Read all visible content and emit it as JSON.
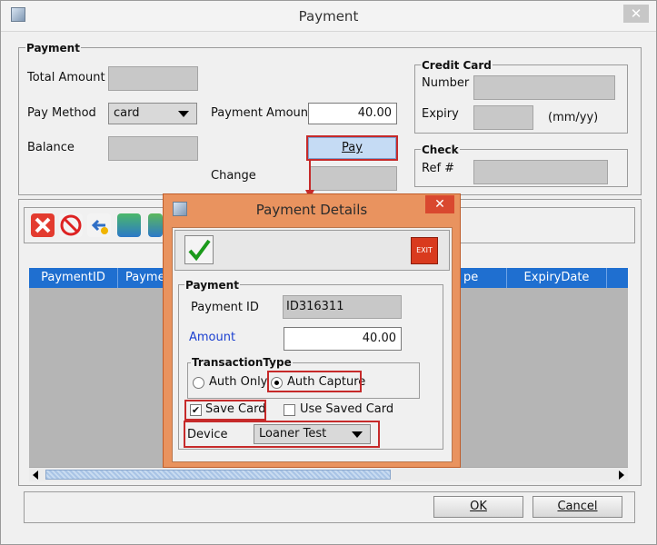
{
  "window": {
    "title": "Payment",
    "close_glyph": "✕"
  },
  "payment": {
    "group_title": "Payment",
    "total_amount_label": "Total Amount",
    "pay_method_label": "Pay Method",
    "pay_method_value": "card",
    "payment_amount_label": "Payment Amount",
    "payment_amount_value": "40.00",
    "balance_label": "Balance",
    "pay_button": "Pay",
    "change_label": "Change"
  },
  "credit_card": {
    "group_title": "Credit Card",
    "number_label": "Number",
    "expiry_label": "Expiry",
    "expiry_hint": "(mm/yy)"
  },
  "check": {
    "group_title": "Check",
    "ref_label": "Ref #"
  },
  "toolbar_icons": [
    "delete-icon",
    "cancel-icon",
    "undo-icon",
    "calculator-icon",
    "money-icon"
  ],
  "table": {
    "columns": [
      "PaymentID",
      "Payme",
      "pe",
      "ExpiryDate"
    ]
  },
  "footer": {
    "ok_button": "OK",
    "cancel_button": "Cancel"
  },
  "dialog": {
    "title": "Payment Details",
    "close_glyph": "✕",
    "exit_label": "EXIT",
    "group_title": "Payment",
    "payment_id_label": "Payment ID",
    "payment_id_value": "ID316311",
    "amount_label": "Amount",
    "amount_value": "40.00",
    "transaction_type_title": "TransactionType",
    "auth_only_label": "Auth Only",
    "auth_capture_label": "Auth Capture",
    "selected_transaction": "Auth Capture",
    "save_card_label": "Save Card",
    "save_card_checked": true,
    "use_saved_card_label": "Use Saved Card",
    "use_saved_card_checked": false,
    "device_label": "Device",
    "device_value": "Loaner Test"
  },
  "colors": {
    "accent_blue": "#1f6fd0",
    "dialog_orange": "#e9935f",
    "highlight_red": "#c62a2a",
    "amount_link": "#1a3fd0"
  }
}
